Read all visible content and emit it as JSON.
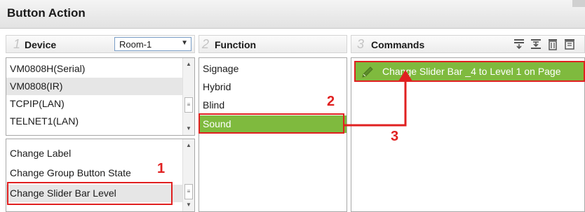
{
  "window": {
    "title": "Button Action"
  },
  "columns": {
    "device": {
      "num": "1",
      "label": "Device"
    },
    "function": {
      "num": "2",
      "label": "Function"
    },
    "commands": {
      "num": "3",
      "label": "Commands"
    }
  },
  "room_select": {
    "value": "Room-1"
  },
  "devices": [
    "VM0808H(Serial)",
    "VM0808(IR)",
    "TCPIP(LAN)",
    "TELNET1(LAN)"
  ],
  "actions": [
    "Change Label",
    "Change Group Button State",
    "Change Slider Bar Level"
  ],
  "functions": [
    "Signage",
    "Hybrid",
    "Blind",
    "Sound"
  ],
  "commands": [
    "Change Slider Bar _4 to Level 1 on Page"
  ],
  "annotations": {
    "step1": "1",
    "step2": "2",
    "step3": "3"
  },
  "toolbar_icons": [
    "move-down-icon",
    "insert-icon",
    "trash-icon",
    "edit-list-icon"
  ],
  "colors": {
    "selected_green": "#7fba3e",
    "annotation_red": "#e02020",
    "selected_grey": "#e6e6e6"
  }
}
